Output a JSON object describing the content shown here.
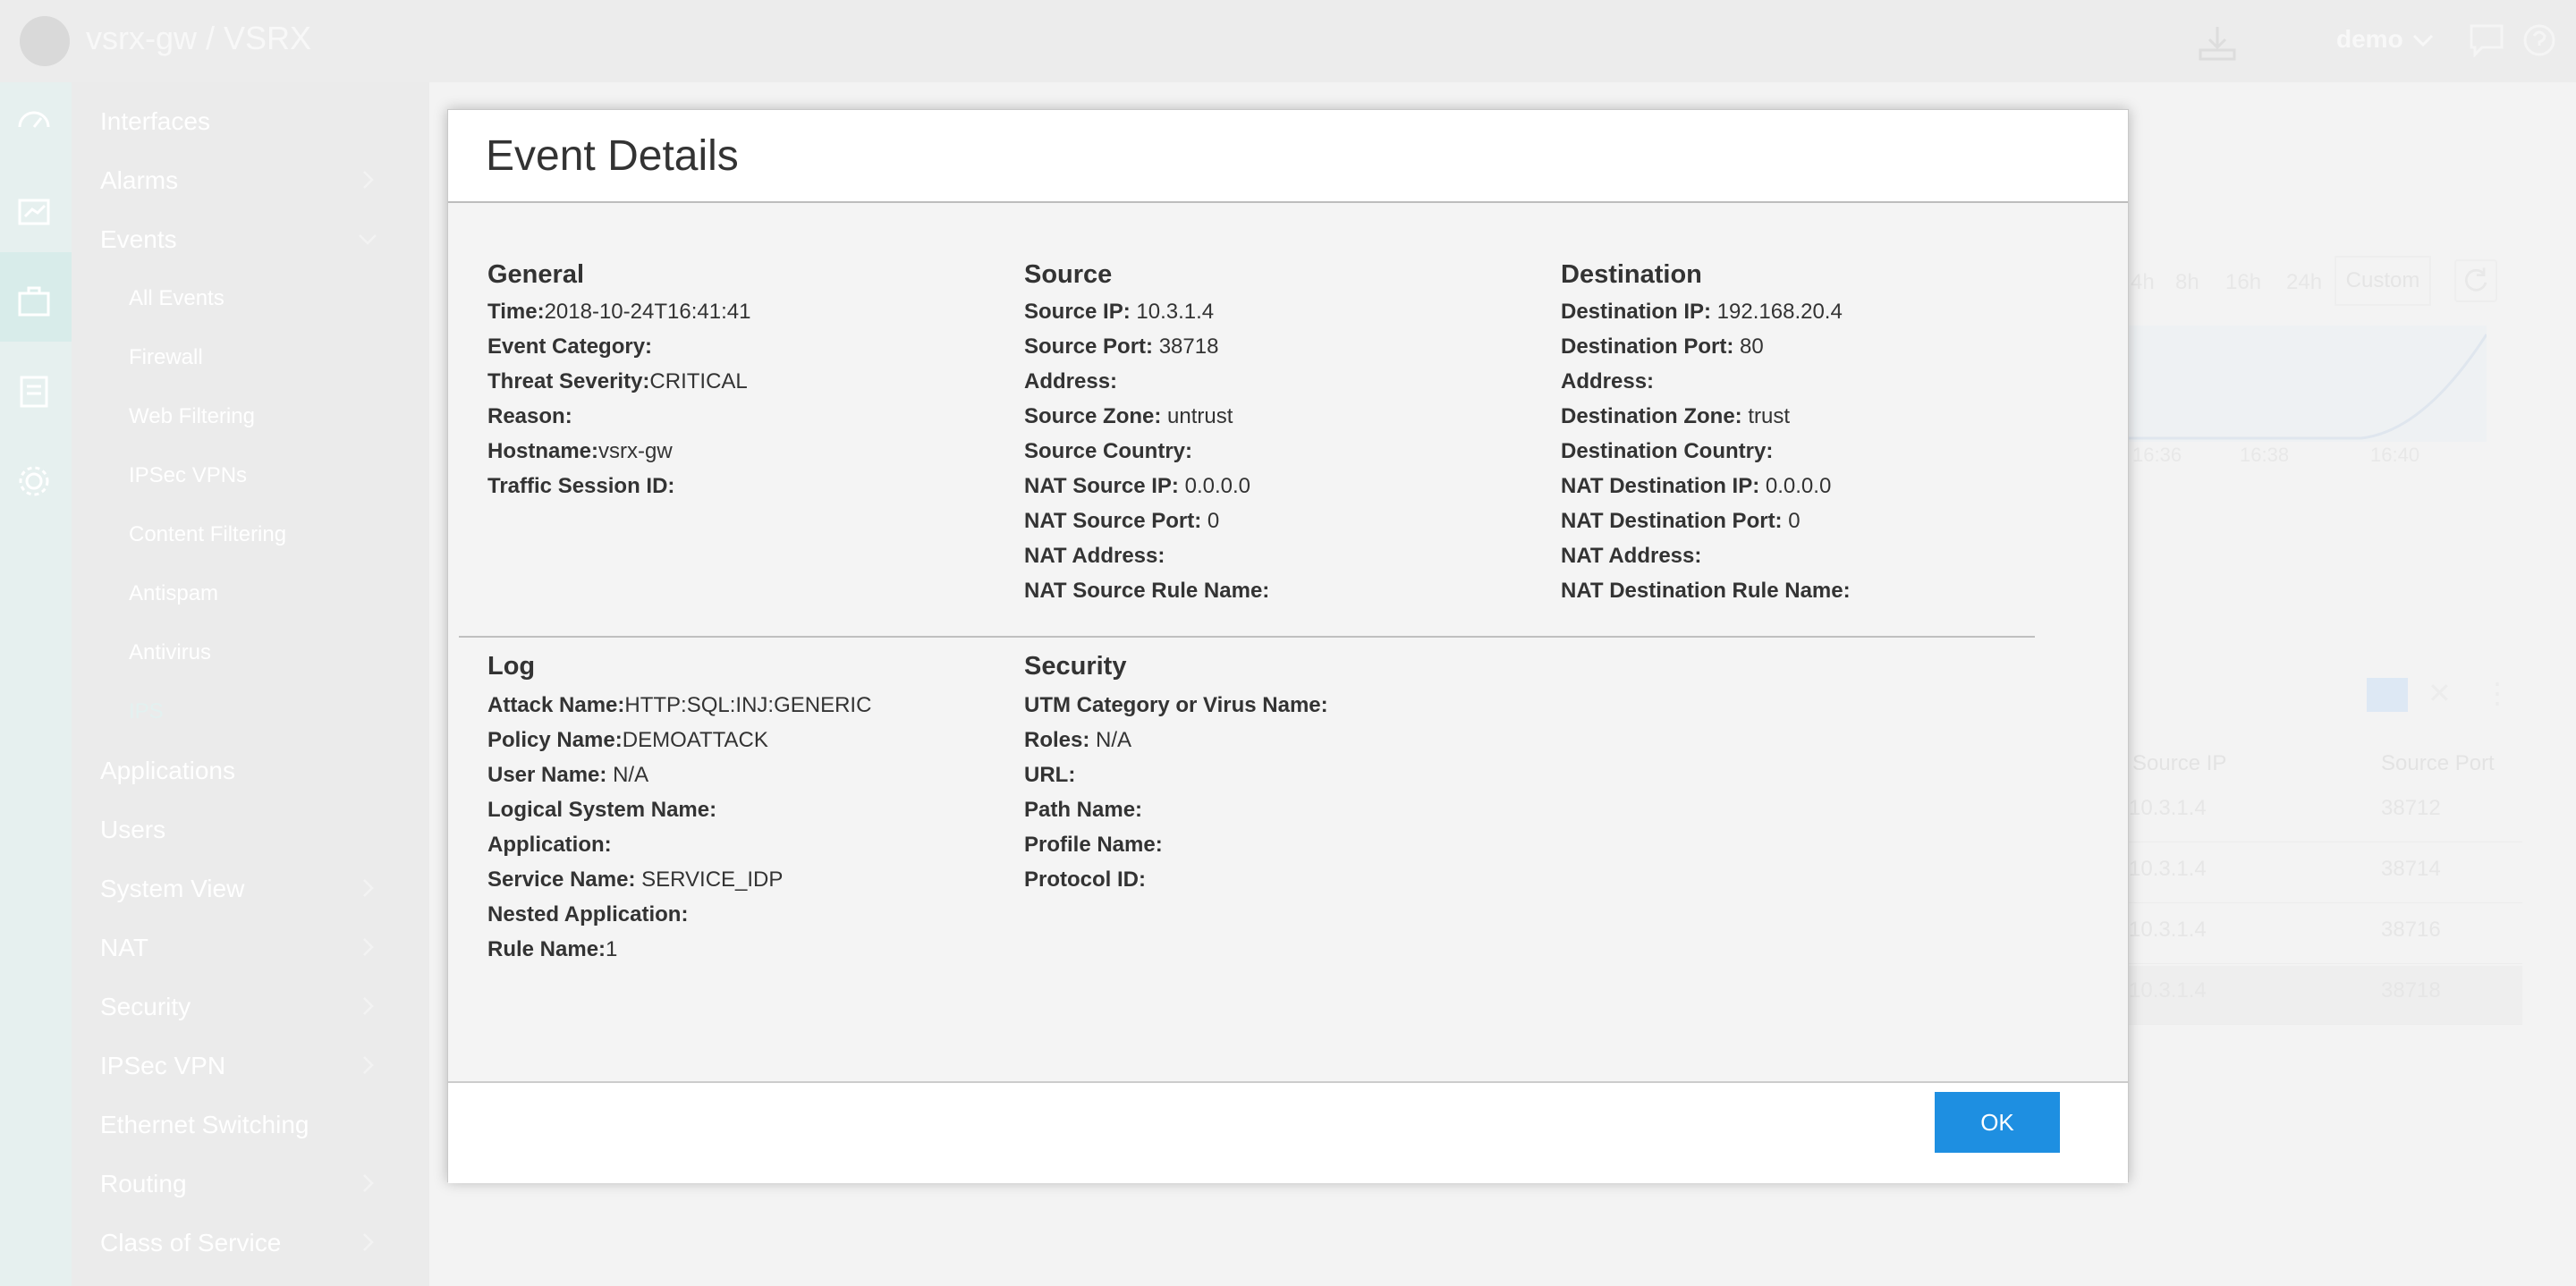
{
  "header": {
    "title": "vsrx-gw / VSRX",
    "user": "demo"
  },
  "sidebar": {
    "items": [
      {
        "label": "Interfaces"
      },
      {
        "label": "Alarms"
      },
      {
        "label": "Events"
      },
      {
        "label": "Applications"
      },
      {
        "label": "Users"
      },
      {
        "label": "System View"
      },
      {
        "label": "NAT"
      },
      {
        "label": "Security"
      },
      {
        "label": "IPSec VPN"
      },
      {
        "label": "Ethernet Switching"
      },
      {
        "label": "Routing"
      },
      {
        "label": "Class of Service"
      }
    ],
    "event_subitems": [
      {
        "label": "All Events"
      },
      {
        "label": "Firewall"
      },
      {
        "label": "Web Filtering"
      },
      {
        "label": "IPSec VPNs"
      },
      {
        "label": "Content Filtering"
      },
      {
        "label": "Antispam"
      },
      {
        "label": "Antivirus"
      },
      {
        "label": "IPS"
      }
    ]
  },
  "background": {
    "time_ranges": [
      "4h",
      "8h",
      "16h",
      "24h"
    ],
    "custom_label": "Custom",
    "chart_x_ticks": [
      "16:36",
      "16:38",
      "16:40"
    ],
    "table_columns": [
      "Source IP",
      "Source Port"
    ],
    "table_rows": [
      {
        "source_ip": "10.3.1.4",
        "source_port": "38712"
      },
      {
        "source_ip": "10.3.1.4",
        "source_port": "38714"
      },
      {
        "source_ip": "10.3.1.4",
        "source_port": "38716"
      },
      {
        "source_ip": "10.3.1.4",
        "source_port": "38718"
      }
    ]
  },
  "modal": {
    "title": "Event Details",
    "ok_label": "OK",
    "general": {
      "title": "General",
      "fields": [
        {
          "k": "Time:",
          "v": "2018-10-24T16:41:41"
        },
        {
          "k": "Event Category:",
          "v": ""
        },
        {
          "k": "Threat Severity:",
          "v": "CRITICAL"
        },
        {
          "k": "Reason:",
          "v": ""
        },
        {
          "k": "Hostname:",
          "v": "vsrx-gw"
        },
        {
          "k": "Traffic Session ID:",
          "v": ""
        }
      ]
    },
    "source": {
      "title": "Source",
      "fields": [
        {
          "k": "Source IP:",
          "v": " 10.3.1.4"
        },
        {
          "k": "Source Port:",
          "v": " 38718"
        },
        {
          "k": "Address:",
          "v": ""
        },
        {
          "k": "Source Zone:",
          "v": " untrust"
        },
        {
          "k": "Source Country:",
          "v": ""
        },
        {
          "k": "NAT Source IP:",
          "v": " 0.0.0.0"
        },
        {
          "k": "NAT Source Port:",
          "v": " 0"
        },
        {
          "k": "NAT Address:",
          "v": ""
        },
        {
          "k": "NAT Source Rule Name:",
          "v": ""
        }
      ]
    },
    "destination": {
      "title": "Destination",
      "fields": [
        {
          "k": "Destination IP:",
          "v": " 192.168.20.4"
        },
        {
          "k": "Destination Port:",
          "v": " 80"
        },
        {
          "k": "Address:",
          "v": ""
        },
        {
          "k": "Destination Zone:",
          "v": " trust"
        },
        {
          "k": "Destination Country:",
          "v": ""
        },
        {
          "k": "NAT Destination IP:",
          "v": " 0.0.0.0"
        },
        {
          "k": "NAT Destination Port:",
          "v": " 0"
        },
        {
          "k": "NAT Address:",
          "v": ""
        },
        {
          "k": "NAT Destination Rule Name:",
          "v": ""
        }
      ]
    },
    "log": {
      "title": "Log",
      "fields": [
        {
          "k": "Attack Name:",
          "v": "HTTP:SQL:INJ:GENERIC"
        },
        {
          "k": "Policy Name:",
          "v": "DEMOATTACK"
        },
        {
          "k": "User Name:",
          "v": " N/A"
        },
        {
          "k": "Logical System Name:",
          "v": ""
        },
        {
          "k": "Application:",
          "v": ""
        },
        {
          "k": "Service Name:",
          "v": " SERVICE_IDP"
        },
        {
          "k": "Nested Application:",
          "v": ""
        },
        {
          "k": "Rule Name:",
          "v": "1"
        }
      ]
    },
    "security": {
      "title": "Security",
      "fields": [
        {
          "k": "UTM Category or Virus Name:",
          "v": ""
        },
        {
          "k": "Roles:",
          "v": " N/A"
        },
        {
          "k": "URL:",
          "v": ""
        },
        {
          "k": "Path Name:",
          "v": ""
        },
        {
          "k": "Profile Name:",
          "v": ""
        },
        {
          "k": "Protocol ID:",
          "v": ""
        }
      ]
    }
  },
  "colors": {
    "accent": "#1e8fe1",
    "modal_bg": "#f4f4f4",
    "overlay_sidebar": "#ebebeb"
  }
}
